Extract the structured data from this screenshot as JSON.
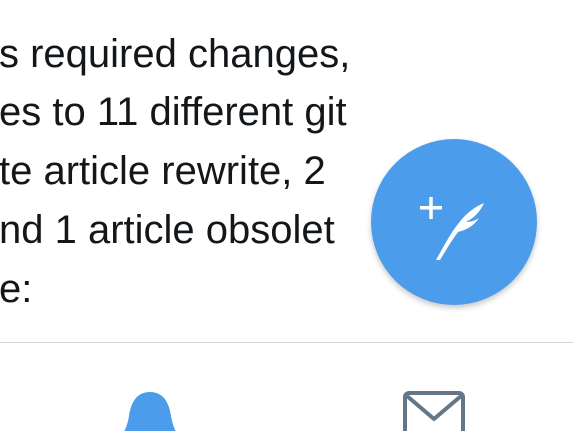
{
  "tweet": {
    "lines": [
      "s required changes,",
      "es to 11 different git",
      "te article rewrite, 2",
      "nd 1 article obsolet",
      "e:"
    ]
  },
  "fab": {
    "icon": "compose-tweet-icon",
    "color": "#4c9cec"
  },
  "tab_bar": {
    "tabs": [
      {
        "icon": "bell-icon",
        "active": true,
        "color": "#4c9cec"
      },
      {
        "icon": "envelope-icon",
        "active": false,
        "color": "#657786"
      }
    ]
  }
}
